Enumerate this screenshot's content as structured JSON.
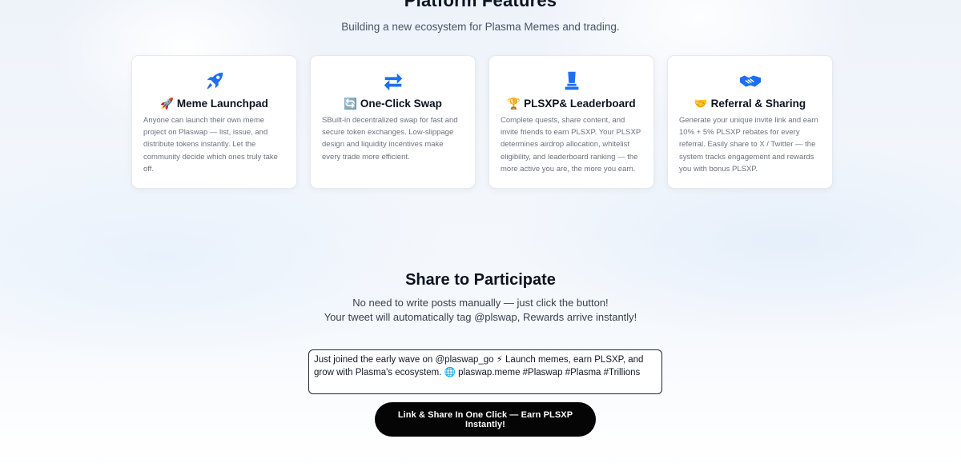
{
  "features": {
    "title": "Platform Features",
    "subtitle": "Building a new ecosystem for Plasma Memes and trading.",
    "cards": [
      {
        "icon": "rocket-icon",
        "title_emoji": "🚀",
        "title": "Meme Launchpad",
        "description": "Anyone can launch their own meme project on Plaswap — list, issue, and distribute tokens instantly. Let the community decide which ones truly take off."
      },
      {
        "icon": "swap-arrows-icon",
        "title_emoji": "🔄",
        "title": "One-Click Swap",
        "description": "SBuilt-in decentralized swap for fast and secure token exchanges. Low-slippage design and liquidity incentives make every trade more efficient."
      },
      {
        "icon": "trophy-icon",
        "title_emoji": "🏆",
        "title": "PLSXP& Leaderboard",
        "description": "Complete quests, share content, and invite friends to earn PLSXP. Your PLSXP determines airdrop allocation, whitelist eligibility, and leaderboard ranking — the more active you are, the more you earn."
      },
      {
        "icon": "handshake-icon",
        "title_emoji": "🤝",
        "title": "Referral & Sharing",
        "description": "Generate your unique invite link and earn 10% + 5% PLSXP rebates for every referral. Easily share to X / Twitter — the system tracks engagement and rewards you with bonus PLSXP."
      }
    ]
  },
  "share": {
    "title": "Share to Participate",
    "line1": "No need to write posts manually — just click the button!",
    "line2": "Your tweet will automatically tag @plswap, Rewards arrive instantly!",
    "tweet_text": "Just joined the early wave on @plaswap_go ⚡ Launch memes, earn PLSXP, and grow with Plasma's ecosystem. 🌐 plaswap.meme #Plaswap #Plasma #Trillions",
    "button_label": "Link & Share In One Click — Earn PLSXP Instantly!"
  },
  "colors": {
    "accent": "#1d6ff2",
    "button_bg": "#050505",
    "title_text": "#0b1220"
  }
}
